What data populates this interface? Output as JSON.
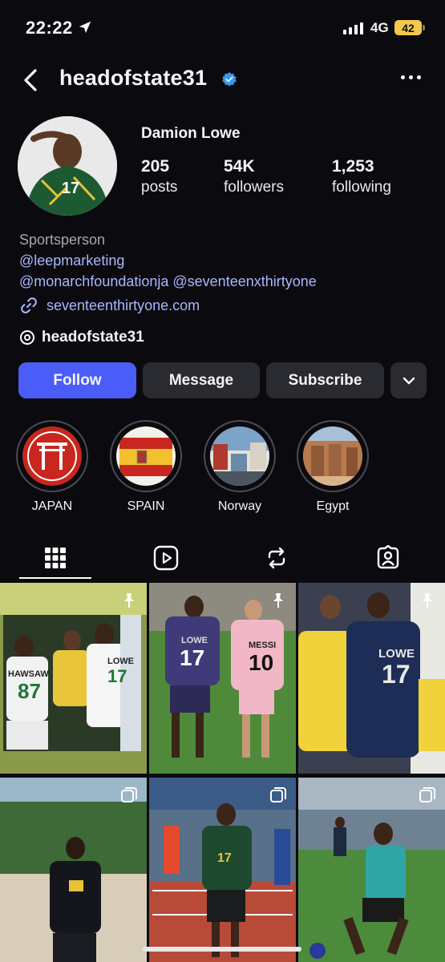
{
  "status_bar": {
    "time": "22:22",
    "network": "4G",
    "battery": "42"
  },
  "header": {
    "username": "headofstate31",
    "verified_icon": "verified-badge-icon",
    "more_icon": "more-options-icon",
    "back_icon": "back-chevron-icon"
  },
  "profile": {
    "full_name": "Damion Lowe",
    "stats": [
      {
        "value": "205",
        "label": "posts"
      },
      {
        "value": "54K",
        "label": "followers"
      },
      {
        "value": "1,253",
        "label": "following"
      }
    ],
    "bio": {
      "category": "Sportsperson",
      "mention1": "@leepmarketing",
      "mention2": "@monarchfoundationja @seventeenxthirtyone",
      "link": "seventeenthirtyone.com"
    },
    "threads_handle": "headofstate31"
  },
  "actions": {
    "follow": "Follow",
    "message": "Message",
    "subscribe": "Subscribe",
    "dropdown_icon": "chevron-down-icon"
  },
  "highlights": [
    {
      "label": "JAPAN"
    },
    {
      "label": "SPAIN"
    },
    {
      "label": "Norway"
    },
    {
      "label": "Egypt"
    }
  ],
  "tabs": [
    "grid-icon",
    "reels-icon",
    "reposts-icon",
    "tagged-icon"
  ],
  "posts": {
    "row1": [
      {
        "jersey_text": "HAWSAW",
        "jersey_number": "87",
        "second_name": "LOWE",
        "second_number": "17",
        "badge": "pinned"
      },
      {
        "jersey_text": "LOWE",
        "jersey_number": "17",
        "second_name": "MESSI",
        "second_number": "10",
        "badge": "pinned"
      },
      {
        "jersey_text": "LOWE",
        "jersey_number": "17",
        "badge": "pinned"
      }
    ],
    "row2": [
      {
        "badge": "carousel"
      },
      {
        "jersey_number": "17",
        "badge": "carousel"
      },
      {
        "badge": "carousel"
      }
    ]
  },
  "colors": {
    "accent": "#4a5df9",
    "background": "#0b0b0f",
    "button": "#2a2b31",
    "link": "#a9b6ff"
  }
}
